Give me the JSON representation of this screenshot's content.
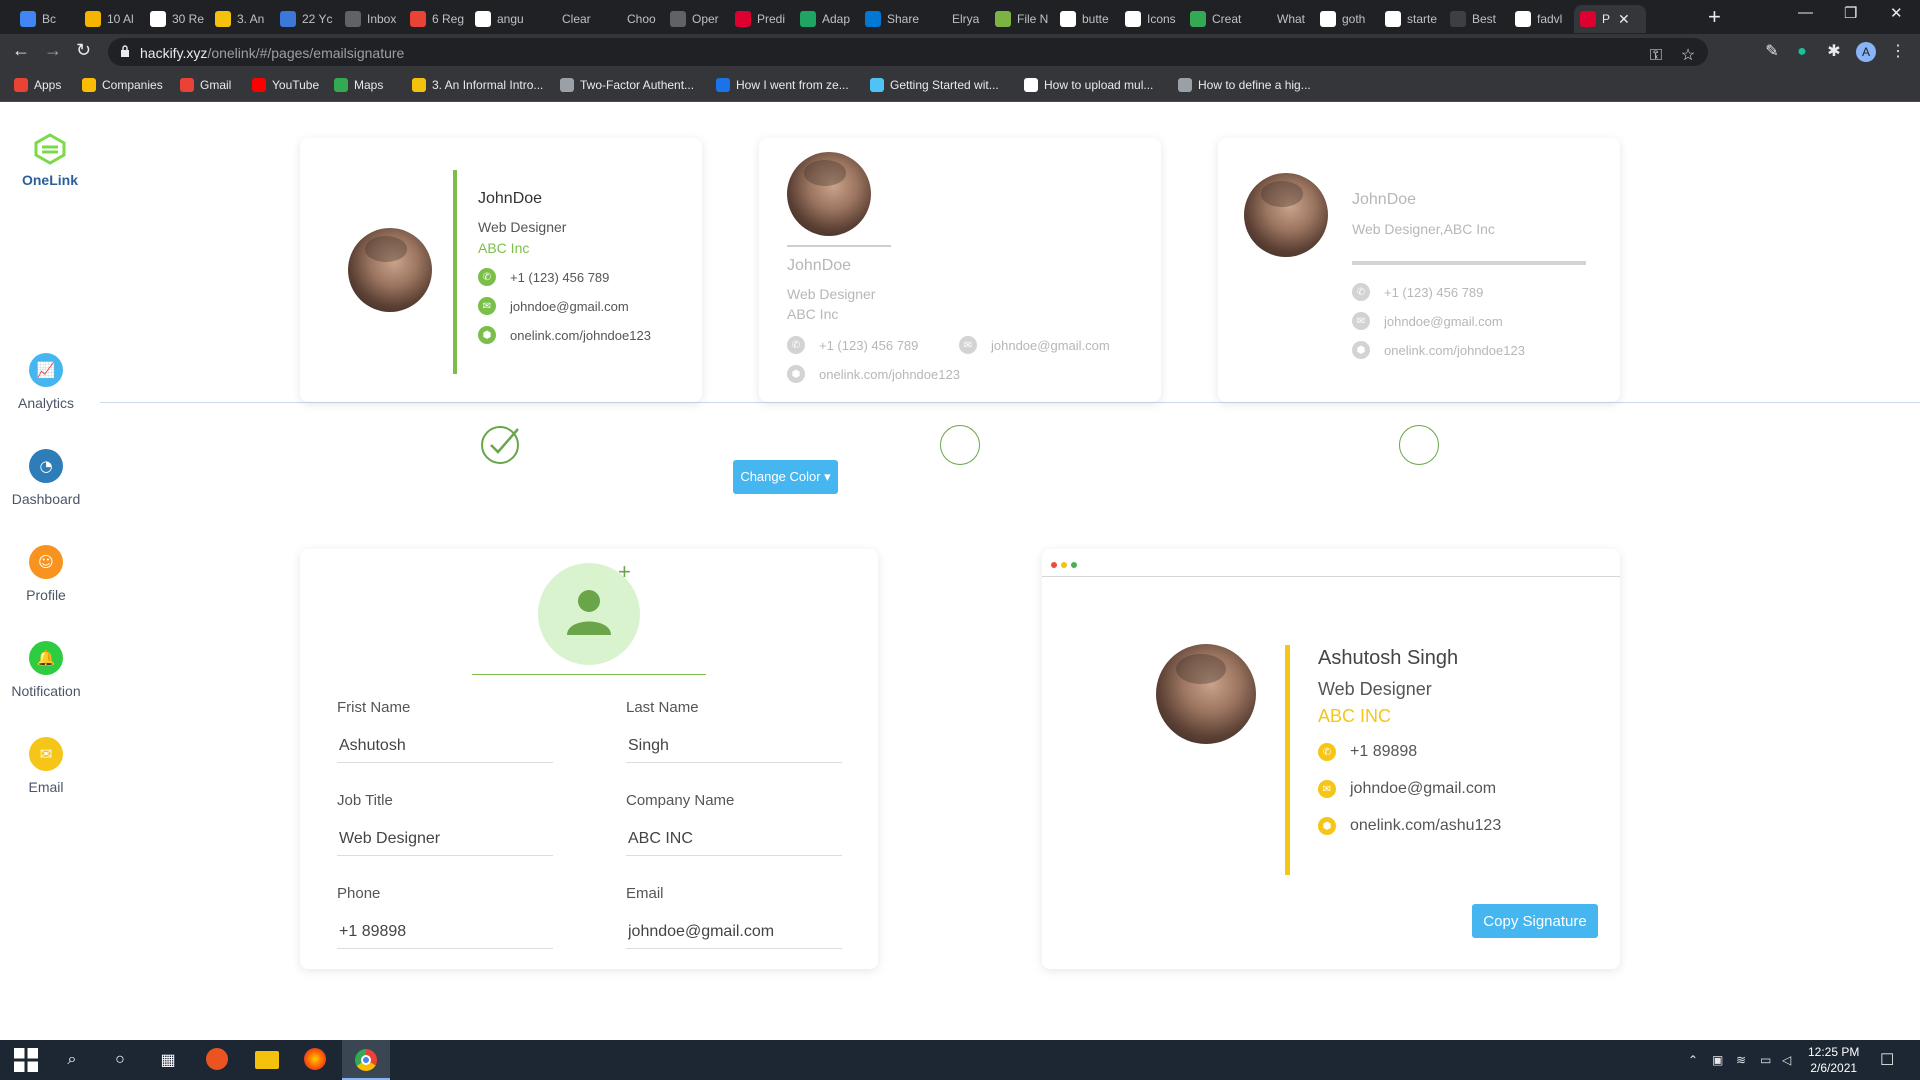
{
  "browser": {
    "tabs": [
      {
        "label": "Bc",
        "color": "#4285f4"
      },
      {
        "label": "10 Al",
        "color": "#f4b400"
      },
      {
        "label": "30 Re",
        "color": "#ffffff"
      },
      {
        "label": "3. An",
        "color": "#f4c20d"
      },
      {
        "label": "22 Yc",
        "color": "#3c78d8"
      },
      {
        "label": "Inbox",
        "color": "#5f6368"
      },
      {
        "label": "6 Reg",
        "color": "#ea4335"
      },
      {
        "label": "angu",
        "color": "#ffffff"
      },
      {
        "label": "Clear",
        "color": "#202124"
      },
      {
        "label": "Choo",
        "color": "#202124"
      },
      {
        "label": "Oper",
        "color": "#5f6368"
      },
      {
        "label": "Predi",
        "color": "#dd0031"
      },
      {
        "label": "Adap",
        "color": "#1fa463"
      },
      {
        "label": "Share",
        "color": "#0078d4"
      },
      {
        "label": "Elrya",
        "color": "#202124"
      },
      {
        "label": "File N",
        "color": "#7cb342"
      },
      {
        "label": "butte",
        "color": "#ffffff"
      },
      {
        "label": "Icons",
        "color": "#ffffff"
      },
      {
        "label": "Creat",
        "color": "#34a853"
      },
      {
        "label": "What",
        "color": "#202124"
      },
      {
        "label": "goth",
        "color": "#ffffff"
      },
      {
        "label": "starte",
        "color": "#ffffff"
      },
      {
        "label": "Best",
        "color": "#3c4043"
      },
      {
        "label": "fadvl",
        "color": "#ffffff"
      },
      {
        "label": "P",
        "color": "#dd0031"
      }
    ],
    "active_tab_close": "✕",
    "new_tab": "+",
    "window_controls": [
      "—",
      "❐",
      "✕"
    ],
    "url_host": "hackify.xyz",
    "url_path": "/onelink/#/pages/emailsignature",
    "bookmarks": [
      {
        "label": "Apps",
        "color": "#ea4335"
      },
      {
        "label": "Companies",
        "color": "#fbbc04"
      },
      {
        "label": "Gmail",
        "color": "#ea4335"
      },
      {
        "label": "YouTube",
        "color": "#ff0000"
      },
      {
        "label": "Maps",
        "color": "#34a853"
      },
      {
        "label": "3. An Informal Intro...",
        "color": "#f4c20d"
      },
      {
        "label": "Two-Factor Authent...",
        "color": "#9aa0a6"
      },
      {
        "label": "How I went from ze...",
        "color": "#1a73e8"
      },
      {
        "label": "Getting Started wit...",
        "color": "#4fc3f7"
      },
      {
        "label": "How to upload mul...",
        "color": "#ffffff"
      },
      {
        "label": "How to define a hig...",
        "color": "#9aa0a6"
      }
    ],
    "profile_letter": "A"
  },
  "sidebar": {
    "logo_text": "OneLink",
    "items": [
      {
        "label": "Analytics",
        "color": "#45b6ef",
        "icon": "chart-icon"
      },
      {
        "label": "Dashboard",
        "color": "#2e7db8",
        "icon": "gauge-icon"
      },
      {
        "label": "Profile",
        "color": "#f7931e",
        "icon": "user-icon"
      },
      {
        "label": "Notification",
        "color": "#2ecc40",
        "icon": "bell-icon"
      },
      {
        "label": "Email",
        "color": "#f5c518",
        "icon": "mail-icon"
      }
    ]
  },
  "templates": [
    {
      "name": "JohnDoe",
      "role": "Web Designer",
      "company": "ABC Inc",
      "phone": "+1 (123) 456 789",
      "email": "johndoe@gmail.com",
      "link": "onelink.com/johndoe123",
      "selected": true
    },
    {
      "name": "JohnDoe",
      "role": "Web Designer",
      "company": "ABC Inc",
      "phone": "+1 (123) 456 789",
      "email": "johndoe@gmail.com",
      "link": "onelink.com/johndoe123",
      "selected": false
    },
    {
      "name": "JohnDoe",
      "role_company": "Web Designer,ABC Inc",
      "phone": "+1 (123) 456 789",
      "email": "johndoe@gmail.com",
      "link": "onelink.com/johndoe123",
      "selected": false
    }
  ],
  "form": {
    "change_color_label": "Change Color ▾",
    "first_name_label": "Frist Name",
    "first_name_value": "Ashutosh",
    "last_name_label": "Last Name",
    "last_name_value": "Singh",
    "job_title_label": "Job Title",
    "job_title_value": "Web Designer",
    "company_label": "Company Name",
    "company_value": "ABC INC",
    "phone_label": "Phone",
    "phone_value": "+1 89898",
    "email_label": "Email",
    "email_value": "johndoe@gmail.com"
  },
  "preview": {
    "name": "Ashutosh Singh",
    "role": "Web Designer",
    "company": "ABC INC",
    "phone": "+1 89898",
    "email": "johndoe@gmail.com",
    "link": "onelink.com/ashu123",
    "accent": "#f5c518",
    "copy_label": "Copy Signature"
  },
  "colors": {
    "green_accent": "#7bbf4a",
    "button_blue": "#45b6ef"
  },
  "taskbar": {
    "time": "12:25 PM",
    "date": "2/6/2021"
  }
}
